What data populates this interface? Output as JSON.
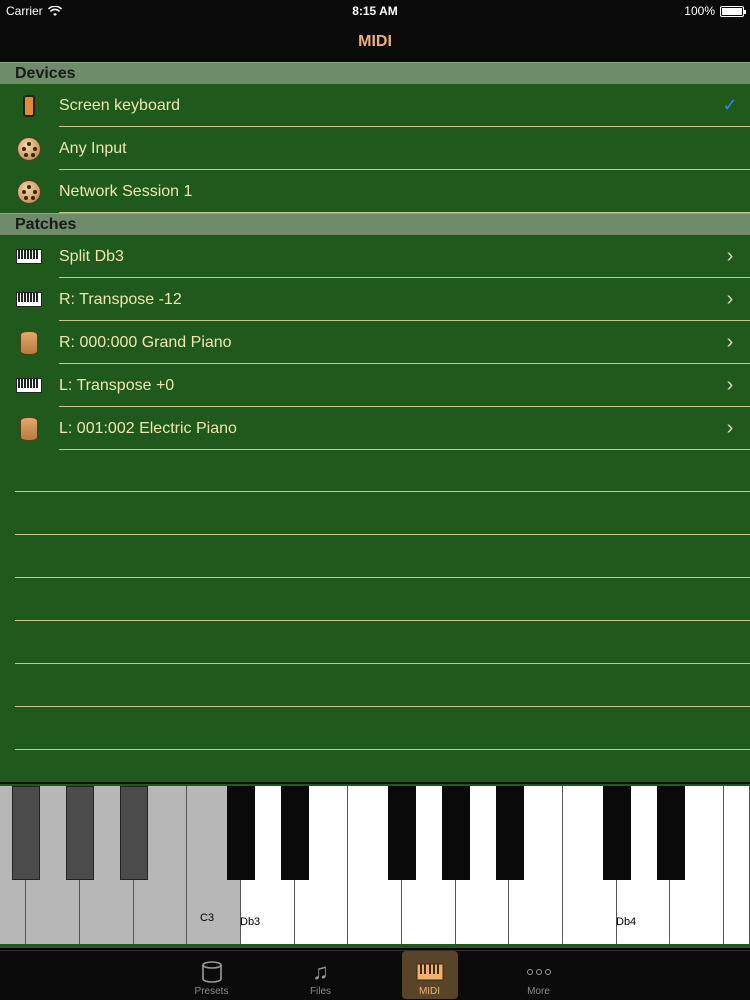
{
  "status": {
    "carrier": "Carrier",
    "time": "8:15 AM",
    "battery": "100%"
  },
  "nav": {
    "title": "MIDI"
  },
  "sections": {
    "devices": {
      "title": "Devices",
      "rows": [
        {
          "label": "Screen keyboard",
          "icon": "phone-icon",
          "checked": true
        },
        {
          "label": "Any Input",
          "icon": "midi-port-icon"
        },
        {
          "label": "Network Session 1",
          "icon": "midi-port-icon"
        }
      ]
    },
    "patches": {
      "title": "Patches",
      "rows": [
        {
          "label": "Split Db3",
          "icon": "keyboard-icon"
        },
        {
          "label": "R: Transpose -12",
          "icon": "keyboard-icon"
        },
        {
          "label": "R: 000:000 Grand Piano",
          "icon": "cylinder-icon"
        },
        {
          "label": "L: Transpose +0",
          "icon": "keyboard-icon"
        },
        {
          "label": "L: 001:002 Electric Piano",
          "icon": "cylinder-icon"
        }
      ]
    }
  },
  "keyboard": {
    "labels": [
      "C3",
      "Db3",
      "Db4"
    ]
  },
  "tabs": [
    {
      "label": "Presets",
      "icon": "presets-icon"
    },
    {
      "label": "Files",
      "icon": "music-note-icon"
    },
    {
      "label": "MIDI",
      "icon": "piano-icon",
      "active": true
    },
    {
      "label": "More",
      "icon": "more-icon"
    }
  ],
  "colors": {
    "table_bg": "#1f5a1c",
    "accent": "#f0b16e",
    "check": "#2f86f0"
  }
}
